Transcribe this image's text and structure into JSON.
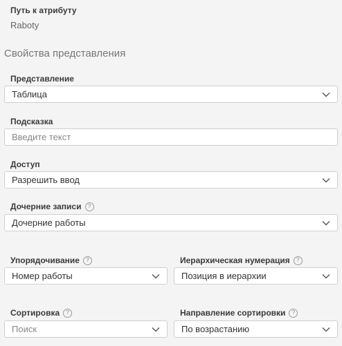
{
  "attribute_path": {
    "label": "Путь к атрибуту",
    "value": "Raboty"
  },
  "section_title": "Свойства представления",
  "view": {
    "label": "Представление",
    "value": "Таблица"
  },
  "hint": {
    "label": "Подсказка",
    "placeholder": "Введите текст",
    "value": ""
  },
  "access": {
    "label": "Доступ",
    "value": "Разрешить ввод"
  },
  "child_records": {
    "label": "Дочерние записи",
    "value": "Дочерние работы"
  },
  "ordering": {
    "label": "Упорядочивание",
    "value": "Номер работы"
  },
  "hierarchical_numbering": {
    "label": "Иерархическая нумерация",
    "value": "Позиция в иерархии"
  },
  "sorting": {
    "label": "Сортировка",
    "placeholder": "Поиск"
  },
  "sort_direction": {
    "label": "Направление сортировки",
    "value": "По возрастанию"
  },
  "icons": {
    "help": "help-icon",
    "dropdown": "chevron-down-icon"
  },
  "help_glyph": "?",
  "colors": {
    "background": "#f4f4f4",
    "field_border": "#cfcfcf",
    "label": "#3a3a3a"
  }
}
